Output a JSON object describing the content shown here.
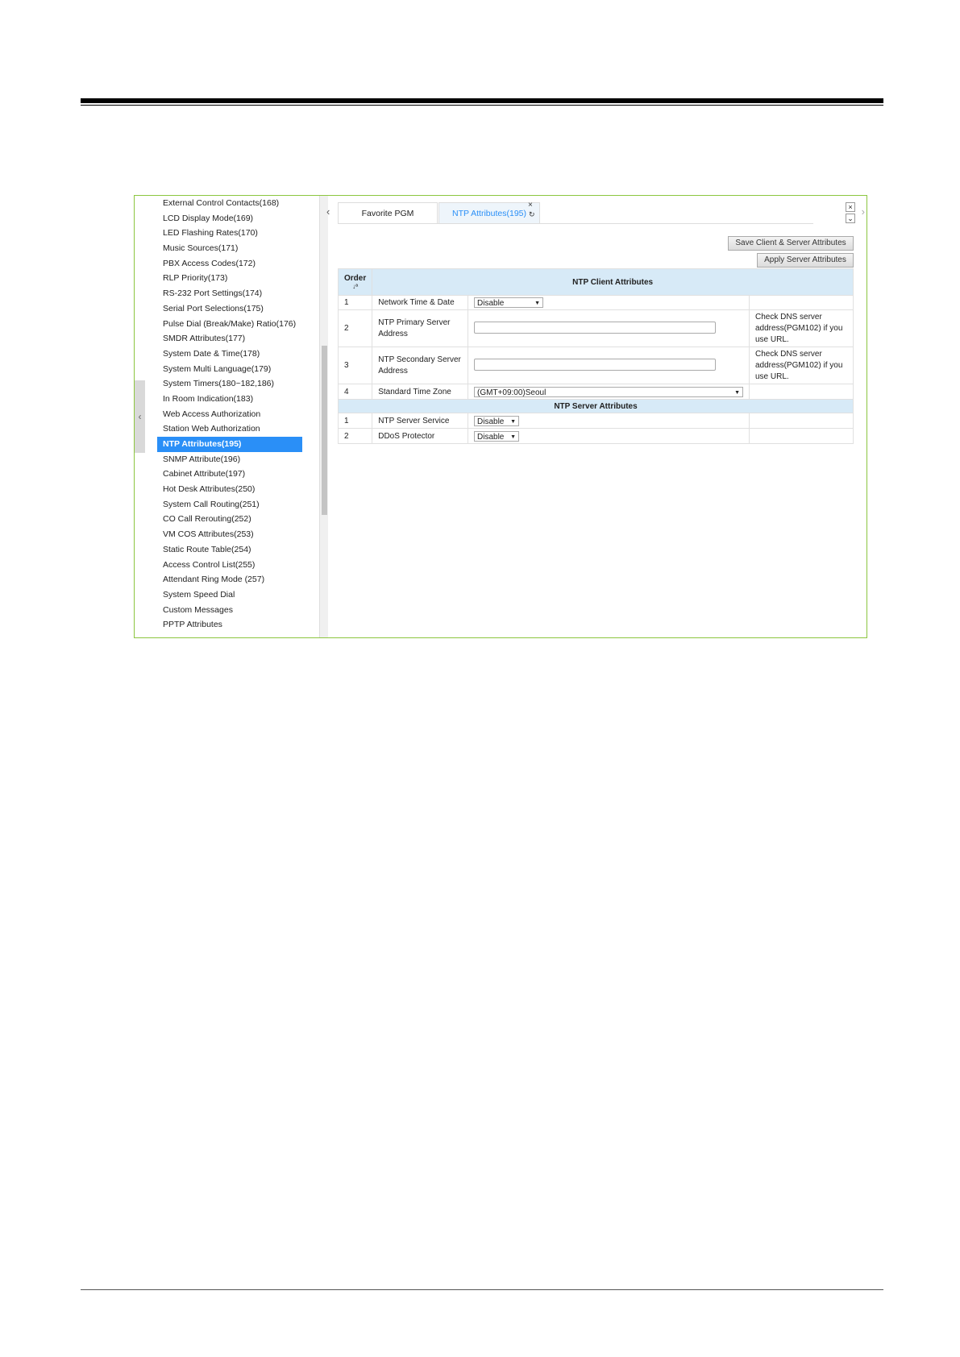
{
  "sidebar": {
    "items": [
      "External Control Contacts(168)",
      "LCD Display Mode(169)",
      "LED Flashing Rates(170)",
      "Music Sources(171)",
      "PBX Access Codes(172)",
      "RLP Priority(173)",
      "RS-232 Port Settings(174)",
      "Serial Port Selections(175)",
      "Pulse Dial (Break/Make) Ratio(176)",
      "SMDR Attributes(177)",
      "System Date & Time(178)",
      "System Multi Language(179)",
      "System Timers(180~182,186)",
      "In Room Indication(183)",
      "Web Access Authorization",
      "Station Web Authorization",
      "NTP Attributes(195)",
      "SNMP Attribute(196)",
      "Cabinet Attribute(197)",
      "Hot Desk Attributes(250)",
      "System Call Routing(251)",
      "CO Call Rerouting(252)",
      "VM COS Attributes(253)",
      "Static Route Table(254)",
      "Access Control List(255)",
      "Attendant Ring Mode (257)",
      "System Speed Dial",
      "Custom Messages",
      "PPTP Attributes"
    ],
    "active_index": 16
  },
  "icons": {
    "collapse": "‹",
    "prev": "‹",
    "next": "›",
    "close": "×",
    "reload": "↻",
    "down": "⌄",
    "sort": "↓ª",
    "arrow": "▼"
  },
  "tabs": [
    "Favorite PGM",
    "NTP Attributes(195)"
  ],
  "buttons": {
    "save": "Save Client & Server Attributes",
    "apply": "Apply Server Attributes"
  },
  "table": {
    "order_header": "Order",
    "client_header": "NTP Client Attributes",
    "server_header": "NTP Server Attributes",
    "client_rows": [
      {
        "order": "1",
        "name": "Network Time & Date",
        "value": "Disable",
        "note": ""
      },
      {
        "order": "2",
        "name": "NTP Primary Server Address",
        "value": "",
        "note": "Check DNS server address(PGM102) if you use URL."
      },
      {
        "order": "3",
        "name": "NTP Secondary Server Address",
        "value": "",
        "note": "Check DNS server address(PGM102) if you use URL."
      },
      {
        "order": "4",
        "name": "Standard Time Zone",
        "value": "(GMT+09:00)Seoul",
        "note": ""
      }
    ],
    "server_rows": [
      {
        "order": "1",
        "name": "NTP Server Service",
        "value": "Disable"
      },
      {
        "order": "2",
        "name": "DDoS Protector",
        "value": "Disable"
      }
    ]
  }
}
